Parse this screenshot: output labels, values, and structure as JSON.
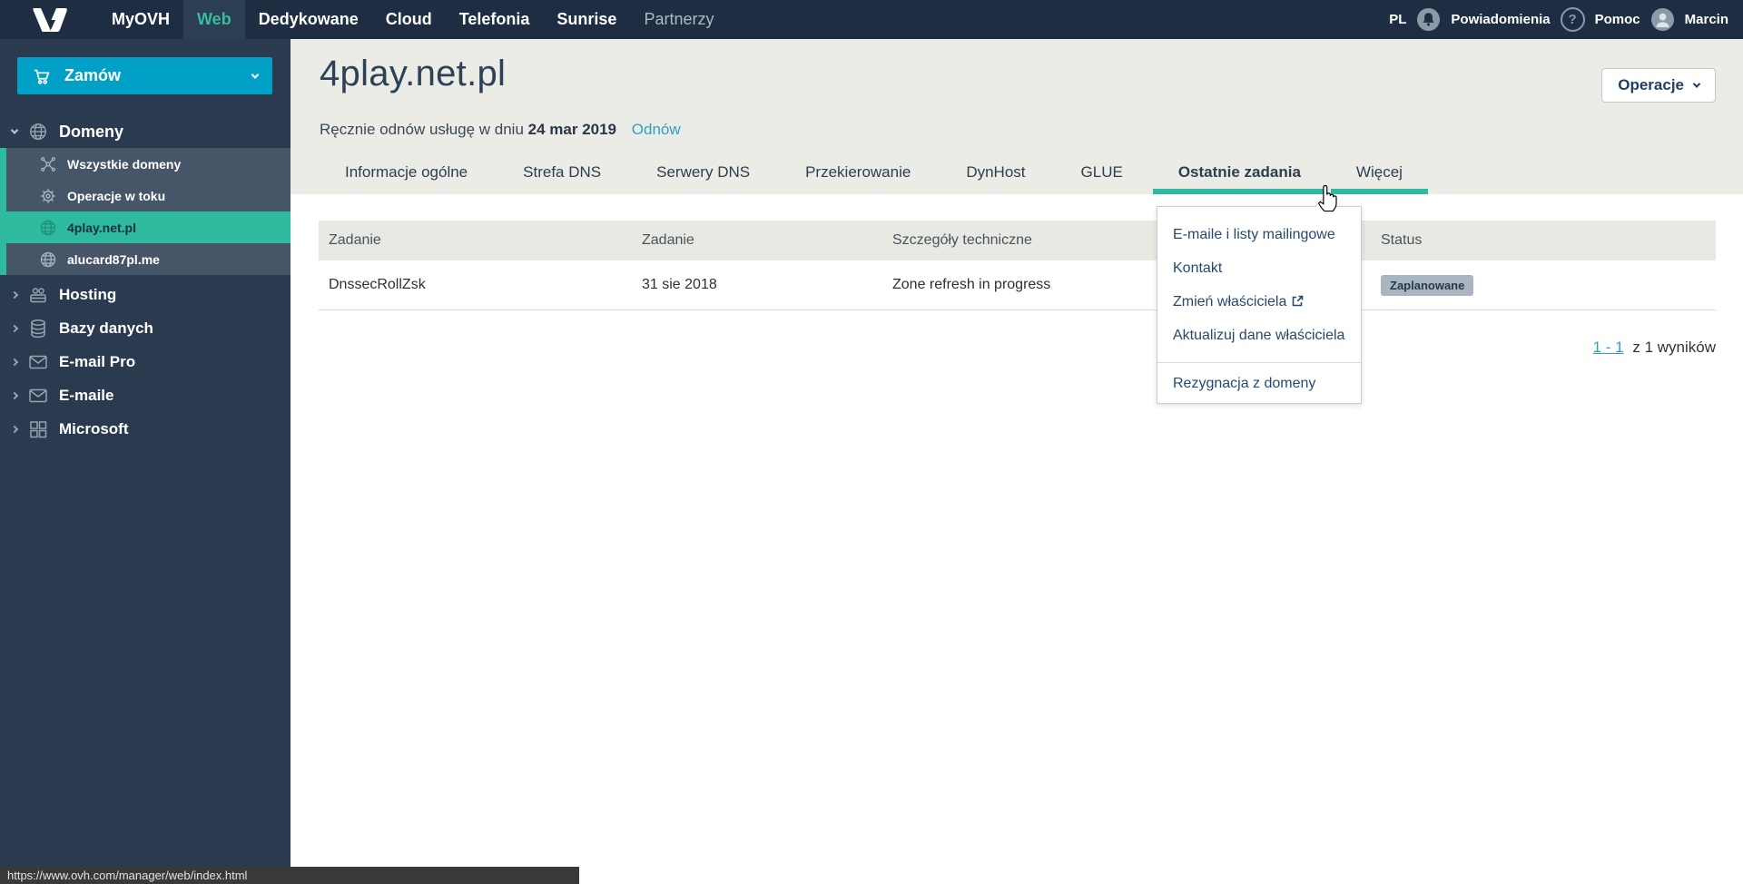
{
  "colors": {
    "accent_teal": "#2eba9e",
    "brand_cyan": "#00a0c7",
    "link_blue": "#2f9fc4",
    "navbar_navy": "#1e2d41"
  },
  "topnav": {
    "items": [
      {
        "label": "MyOVH"
      },
      {
        "label": "Web"
      },
      {
        "label": "Dedykowane"
      },
      {
        "label": "Cloud"
      },
      {
        "label": "Telefonia"
      },
      {
        "label": "Sunrise"
      },
      {
        "label": "Partnerzy"
      }
    ],
    "locale": "PL",
    "notifications_label": "Powiadomienia",
    "help_label": "Pomoc",
    "help_glyph": "?",
    "username": "Marcin"
  },
  "sidebar": {
    "order_label": "Zamów",
    "group_label": "Domeny",
    "group_children": [
      {
        "label": "Wszystkie domeny"
      },
      {
        "label": "Operacje w toku"
      },
      {
        "label": "4play.net.pl"
      },
      {
        "label": "alucard87pl.me"
      }
    ],
    "items": [
      {
        "label": "Hosting"
      },
      {
        "label": "Bazy danych"
      },
      {
        "label": "E-mail Pro"
      },
      {
        "label": "E-maile"
      },
      {
        "label": "Microsoft"
      }
    ]
  },
  "page": {
    "title": "4play.net.pl",
    "renew_text": "Ręcznie odnów usługę w dniu",
    "renew_date": "24 mar 2019",
    "renew_action": "Odnów",
    "operations_label": "Operacje"
  },
  "tabs": [
    {
      "label": "Informacje ogólne"
    },
    {
      "label": "Strefa DNS"
    },
    {
      "label": "Serwery DNS"
    },
    {
      "label": "Przekierowanie"
    },
    {
      "label": "DynHost"
    },
    {
      "label": "GLUE"
    },
    {
      "label": "Ostatnie zadania"
    },
    {
      "label": "Więcej"
    }
  ],
  "more_menu": {
    "items": [
      {
        "label": "E-maile i listy mailingowe"
      },
      {
        "label": "Kontakt"
      },
      {
        "label": "Zmień właściciela"
      },
      {
        "label": "Aktualizuj dane właściciela"
      },
      {
        "label": "Rezygnacja z domeny"
      }
    ]
  },
  "tasks_table": {
    "headers": [
      {
        "label": "Zadanie"
      },
      {
        "label": "Zadanie"
      },
      {
        "label": "Szczegóły techniczne"
      },
      {
        "label": "Status"
      }
    ],
    "rows": [
      {
        "task": "DnssecRollZsk",
        "date": "31 sie 2018",
        "details": "Zone refresh in progress",
        "status": "Zaplanowane"
      }
    ]
  },
  "pagination": {
    "range_link": "1 - 1",
    "summary": "z 1 wyników"
  },
  "statusbar": {
    "url": "https://www.ovh.com/manager/web/index.html"
  }
}
